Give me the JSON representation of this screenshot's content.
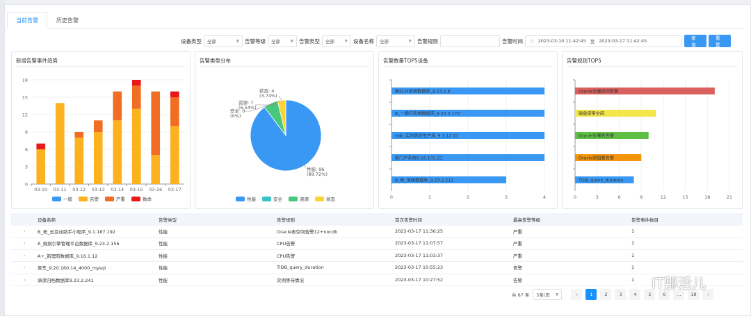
{
  "tabs": [
    {
      "label": "当前告警",
      "active": true
    },
    {
      "label": "历史告警",
      "active": false
    }
  ],
  "filters": {
    "device_type_label": "设备类型",
    "device_type_value": "全部",
    "level_label": "告警等级",
    "level_value": "全部",
    "alarm_type_label": "告警类型",
    "alarm_type_value": "全部",
    "device_name_label": "设备名称",
    "device_name_value": "全部",
    "rule_label": "告警规则",
    "rule_value": "",
    "time_label": "告警时间",
    "time_start": "2023-03-10 11:42:45",
    "time_sep": "至",
    "time_end": "2023-03-17 11:42:45",
    "query_button": "查询",
    "reset_button": "重置"
  },
  "panels": {
    "trend_title": "新增告警事件趋势",
    "pie_title": "告警类型分布",
    "device_title": "告警数量TOP5设备",
    "rule_title": "告警规则TOP5"
  },
  "colors": {
    "general": "#3a98f5",
    "warning": "#fbb21e",
    "severe": "#f26d24",
    "fatal": "#e61a1a",
    "perf": "#3a98f5",
    "safe": "#36c5c6",
    "resource": "#48c87a",
    "status": "#fad337",
    "accent": "#1890ff"
  },
  "chart_data": [
    {
      "type": "bar",
      "stacked": true,
      "categories": [
        "03-10",
        "03-11",
        "03-12",
        "03-13",
        "03-14",
        "03-15",
        "03-16",
        "03-17"
      ],
      "series": [
        {
          "name": "一般",
          "values": [
            0,
            0,
            0,
            0,
            0,
            0,
            0,
            0
          ]
        },
        {
          "name": "告警",
          "values": [
            6,
            14,
            8,
            9,
            11,
            13,
            5,
            10
          ]
        },
        {
          "name": "严重",
          "values": [
            0,
            0,
            1,
            2,
            5,
            4,
            11,
            5
          ]
        },
        {
          "name": "致命",
          "values": [
            1,
            0,
            0,
            0,
            0,
            1,
            0,
            1
          ]
        }
      ],
      "yticks": [
        0,
        3,
        6,
        9,
        12,
        15,
        18
      ],
      "ylim": [
        0,
        18
      ],
      "legend": "bottom"
    },
    {
      "type": "pie",
      "slices": [
        {
          "name": "性能",
          "value": 96,
          "percent": "89.72%",
          "label": "性能: 96",
          "label2": "(89.72%)"
        },
        {
          "name": "安全",
          "value": 0,
          "percent": "0%",
          "label": "安全: 0",
          "label2": "(0%)"
        },
        {
          "name": "资源",
          "value": 7,
          "percent": "6.54%",
          "label": "资源: 7",
          "label2": "(6.54%)"
        },
        {
          "name": "状态",
          "value": 4,
          "percent": "3.74%",
          "label": "状态: 4",
          "label2": "(3.74%)"
        }
      ],
      "legend": "bottom"
    },
    {
      "type": "bar",
      "orientation": "horizontal",
      "categories": [
        "新ECIF系统数据库_9.23.2.6",
        "B_一期行系统数据库_9.23.2.172",
        "tidb_实时表验生产库_9.1.12.31",
        "新门户系统9.16.101.21",
        "B_新_填缘数据库_9.23.2.212"
      ],
      "values": [
        4,
        4,
        4,
        4,
        3
      ],
      "xticks": [
        0,
        1,
        2,
        3,
        4
      ],
      "xlim": [
        0,
        4
      ]
    },
    {
      "type": "bar",
      "orientation": "horizontal",
      "categories": [
        "Oracle全量访问告警",
        "磁盘使用空间",
        "Oracle长事务告警",
        "Oracle锁阻塞告警",
        "TiDB_query_duration"
      ],
      "values": [
        19,
        11,
        10,
        9,
        8
      ],
      "colors": [
        "#d9605d",
        "#f3e54a",
        "#5fbf45",
        "#f2950c",
        "#3a98f5"
      ],
      "xticks": [
        0,
        3,
        6,
        9,
        12,
        15,
        18,
        21
      ],
      "xlim": [
        0,
        21
      ]
    }
  ],
  "table": {
    "headers": [
      "设备名称",
      "告警类型",
      "告警规则",
      "首次告警时间",
      "最高告警等级",
      "告警事件数目"
    ],
    "rows": [
      [
        "B_老_云互动助手小程序_9.1.187.192",
        "性能",
        "Oracle表空间告警12+nocdb",
        "2023-03-17 11:36:25",
        "严重",
        "1"
      ],
      [
        "A_规则引擎管理平台数据库_9.23.2.156",
        "性能",
        "CPU告警",
        "2023-03-17 11:07:57",
        "严重",
        "1"
      ],
      [
        "A+_新理赔数据库_9.16.1.12",
        "性能",
        "CPU告警",
        "2023-03-17 11:03:37",
        "严重",
        "1"
      ],
      [
        "至东_9.20.160.14_4000_mysql",
        "性能",
        "TiDB_query_duration",
        "2023-03-17 10:55:23",
        "告警",
        "1"
      ],
      [
        "承保归档数据库9.23.2.241",
        "性能",
        "实例等待情况",
        "2023-03-17 10:27:52",
        "告警",
        "1"
      ]
    ]
  },
  "pager": {
    "total": "共 87 条",
    "page_size": "5条/页",
    "pages": [
      "1",
      "2",
      "3",
      "4",
      "5",
      "6",
      "...",
      "18"
    ],
    "current": "1"
  },
  "watermark": {
    "text": "IT那活儿"
  }
}
